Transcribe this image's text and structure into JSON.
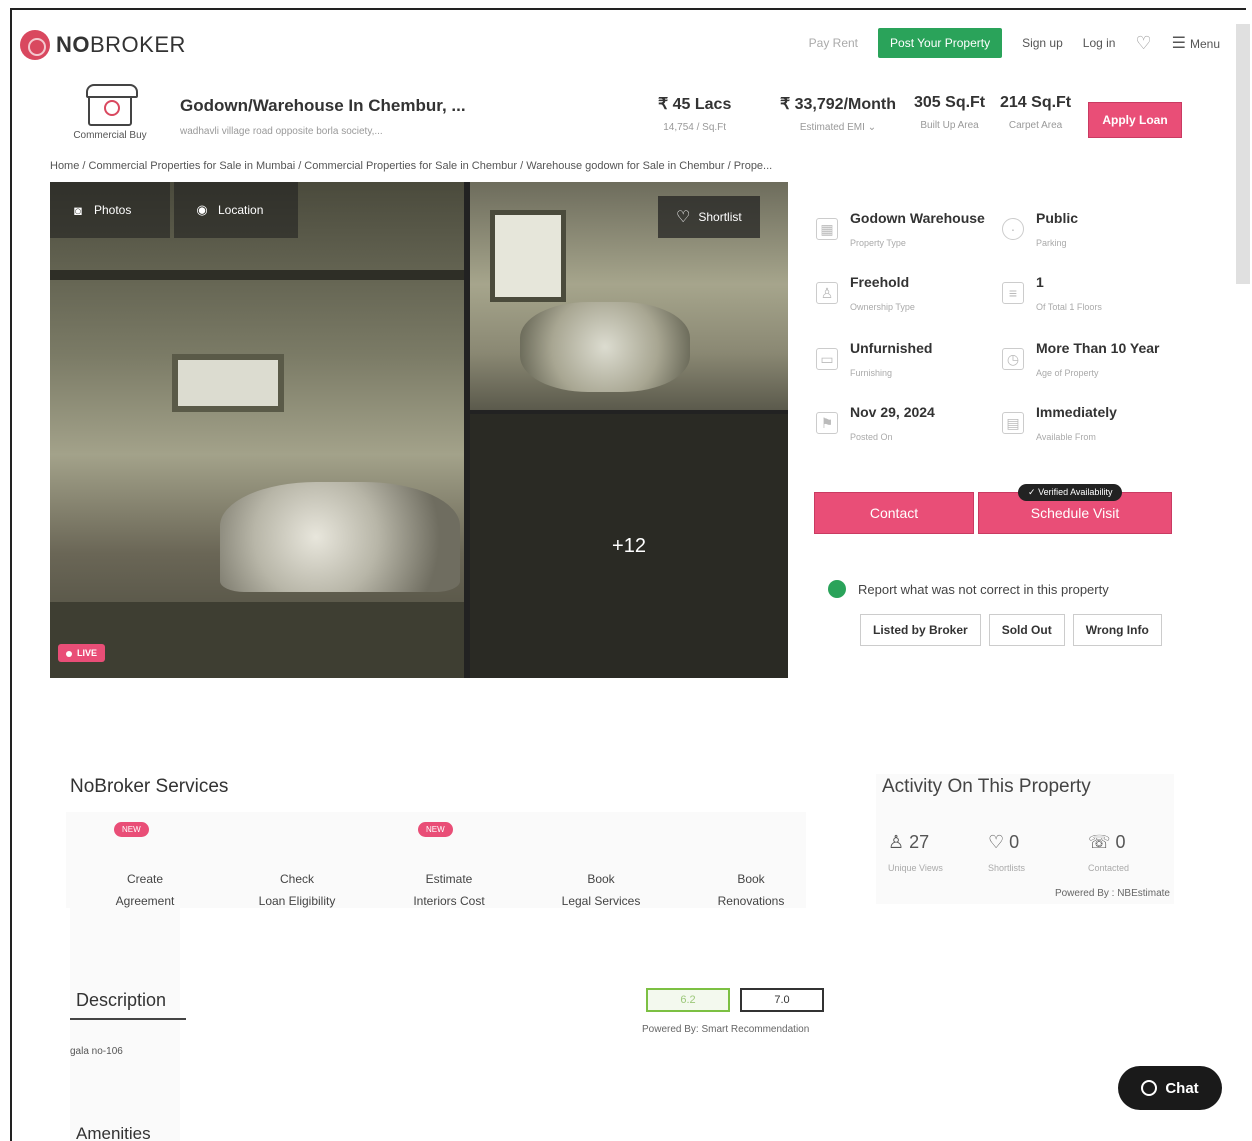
{
  "nav": {
    "logo": "NOBROKER",
    "pay_rent": "Pay Rent",
    "post_property": "Post Your Property",
    "sign_up": "Sign up",
    "log_in": "Log in",
    "menu": "Menu"
  },
  "property": {
    "category": "Commercial Buy",
    "title": "Godown/Warehouse In Chembur, ...",
    "address": "wadhavli village road opposite borla society,...",
    "price": "₹ 45 Lacs",
    "price_sub": "14,754 / Sq.Ft",
    "emi": "₹ 33,792/Month",
    "emi_sub": "Estimated EMI",
    "builtup": "305 Sq.Ft",
    "builtup_sub": "Built Up Area",
    "carpet": "214 Sq.Ft",
    "carpet_sub": "Carpet Area",
    "apply_loan": "Apply Loan"
  },
  "breadcrumb": "Home / Commercial Properties for Sale in Mumbai / Commercial Properties for Sale in Chembur / Warehouse godown for Sale in Chembur / Prope...",
  "gallery": {
    "photos_tab": "Photos",
    "location_tab": "Location",
    "shortlist": "Shortlist",
    "more_count": "+12",
    "live": "LIVE"
  },
  "details": [
    {
      "value": "Godown Warehouse",
      "label": "Property Type",
      "icon": "building-icon"
    },
    {
      "value": "Public",
      "label": "Parking",
      "icon": "parking-icon"
    },
    {
      "value": "Freehold",
      "label": "Ownership Type",
      "icon": "ownership-icon"
    },
    {
      "value": "1",
      "label": "Of Total 1 Floors",
      "icon": "floor-icon"
    },
    {
      "value": "Unfurnished",
      "label": "Furnishing",
      "icon": "furnishing-icon"
    },
    {
      "value": "More Than 10 Year",
      "label": "Age of Property",
      "icon": "age-icon"
    },
    {
      "value": "Nov 29, 2024",
      "label": "Posted On",
      "icon": "flag-icon"
    },
    {
      "value": "Immediately",
      "label": "Available From",
      "icon": "calendar-icon"
    }
  ],
  "actions": {
    "contact": "Contact",
    "schedule_visit": "Schedule Visit",
    "verified": "Verified Availability"
  },
  "report": {
    "text": "Report what was not correct in this property",
    "buttons": [
      "Listed by Broker",
      "Sold Out",
      "Wrong Info"
    ]
  },
  "services": {
    "title": "NoBroker Services",
    "new_badge": "NEW",
    "items": [
      {
        "line1": "Create",
        "line2": "Agreement",
        "new": true
      },
      {
        "line1": "Check",
        "line2": "Loan Eligibility",
        "new": false
      },
      {
        "line1": "Estimate",
        "line2": "Interiors Cost",
        "new": true
      },
      {
        "line1": "Book",
        "line2": "Legal Services",
        "new": false
      },
      {
        "line1": "Book",
        "line2": "Renovations",
        "new": false
      }
    ]
  },
  "activity": {
    "title": "Activity On This Property",
    "unique_views": "27",
    "unique_views_label": "Unique Views",
    "shortlists": "0",
    "shortlists_label": "Shortlists",
    "contacted": "0",
    "contacted_label": "Contacted",
    "powered_by": "Powered By : NBEstimate"
  },
  "description": {
    "title": "Description",
    "text": "gala no-106"
  },
  "scores": {
    "score1": "6.2",
    "score2": "7.0",
    "powered_by": "Powered By: Smart Recommendation"
  },
  "amenities_title": "Amenities",
  "chat": "Chat",
  "colors": {
    "brand": "#d9485f",
    "accent_pink": "#e94e77",
    "post_green": "#2aa35a"
  }
}
